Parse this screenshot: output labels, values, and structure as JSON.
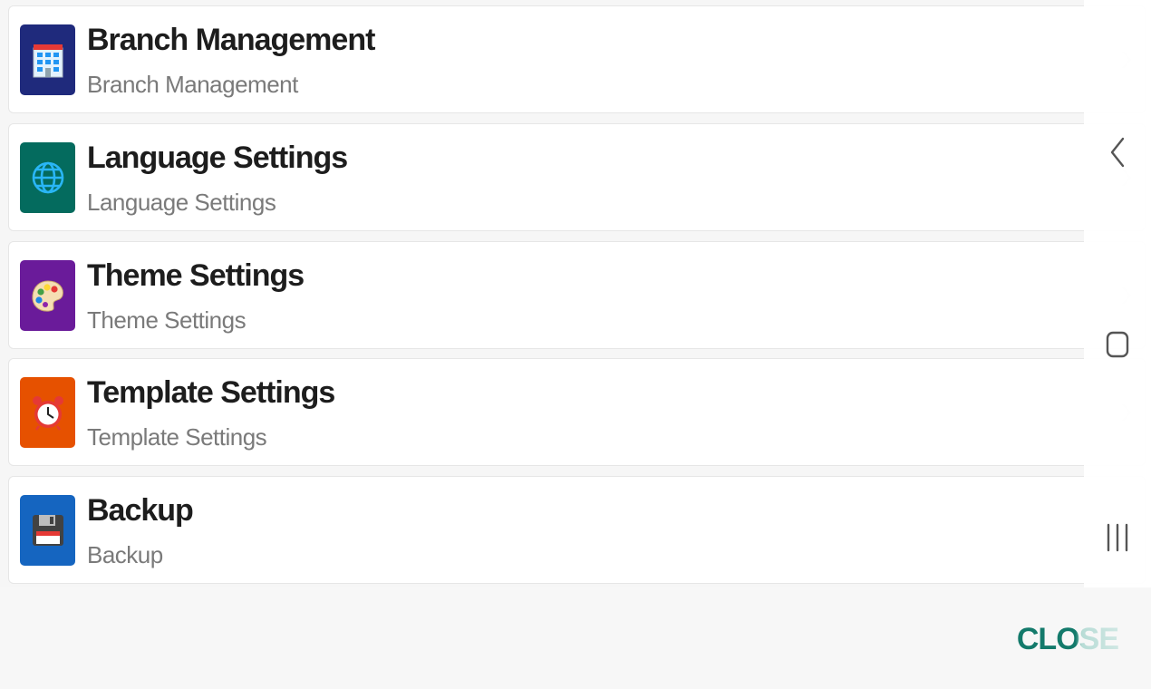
{
  "items": [
    {
      "title": "Branch Management",
      "subtitle": "Branch Management",
      "icon": "office-building-icon",
      "color": "#1f2a7c"
    },
    {
      "title": "Language Settings",
      "subtitle": "Language Settings",
      "icon": "globe-icon",
      "color": "#046b5e"
    },
    {
      "title": "Theme Settings",
      "subtitle": "Theme Settings",
      "icon": "palette-icon",
      "color": "#6a1b9a"
    },
    {
      "title": "Template Settings",
      "subtitle": "Template Settings",
      "icon": "alarm-clock-icon",
      "color": "#e65100"
    },
    {
      "title": "Backup",
      "subtitle": "Backup",
      "icon": "floppy-disk-icon",
      "color": "#1565c0"
    }
  ],
  "footer": {
    "close_label": "CLOSE",
    "close_color": "#137a6b"
  },
  "navbar": {
    "icons": [
      "back-icon",
      "home-icon",
      "recent-apps-icon"
    ]
  }
}
